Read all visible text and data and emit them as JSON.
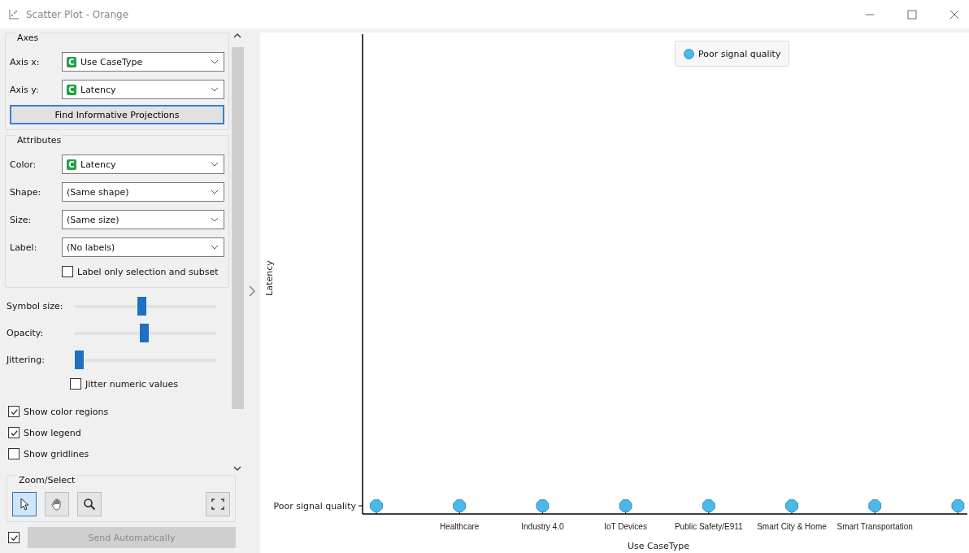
{
  "window": {
    "title": "Scatter Plot - Orange"
  },
  "axes": {
    "title": "Axes",
    "rows": [
      {
        "label": "Axis x:",
        "value": "Use CaseType",
        "badge": "C"
      },
      {
        "label": "Axis y:",
        "value": "Latency",
        "badge": "C"
      }
    ],
    "button": "Find Informative Projections"
  },
  "attributes": {
    "title": "Attributes",
    "rows": [
      {
        "label": "Color:",
        "value": "Latency",
        "badge": "C"
      },
      {
        "label": "Shape:",
        "value": "(Same shape)"
      },
      {
        "label": "Size:",
        "value": "(Same size)"
      },
      {
        "label": "Label:",
        "value": "(No labels)"
      }
    ],
    "label_only": {
      "label": "Label only selection and subset",
      "checked": false
    }
  },
  "sliders": [
    {
      "label": "Symbol size:",
      "level": 0.48
    },
    {
      "label": "Opacity:",
      "level": 0.5
    },
    {
      "label": "Jittering:",
      "level": 0.0
    }
  ],
  "jitter_numeric": {
    "label": "Jitter numeric values",
    "checked": false
  },
  "options": [
    {
      "label": "Show color regions",
      "checked": true
    },
    {
      "label": "Show legend",
      "checked": true
    },
    {
      "label": "Show gridlines",
      "checked": false
    }
  ],
  "zoom_select": {
    "title": "Zoom/Select",
    "tools": [
      {
        "kind": "select",
        "selected": true
      },
      {
        "kind": "pan",
        "selected": false
      },
      {
        "kind": "zoom",
        "selected": false
      }
    ]
  },
  "send": {
    "checked": true,
    "label": "Send Automatically"
  },
  "plot": {
    "legend": "Poor signal quality",
    "ylabel": "Latency",
    "y_category": "Poor signal quality",
    "x_categories": [
      "Healthcare",
      "Industry 4.0",
      "IoT Devices",
      "Public Safety/E911",
      "Smart City & Home",
      "Smart Transportation"
    ],
    "xlabel": "Use CaseType"
  }
}
